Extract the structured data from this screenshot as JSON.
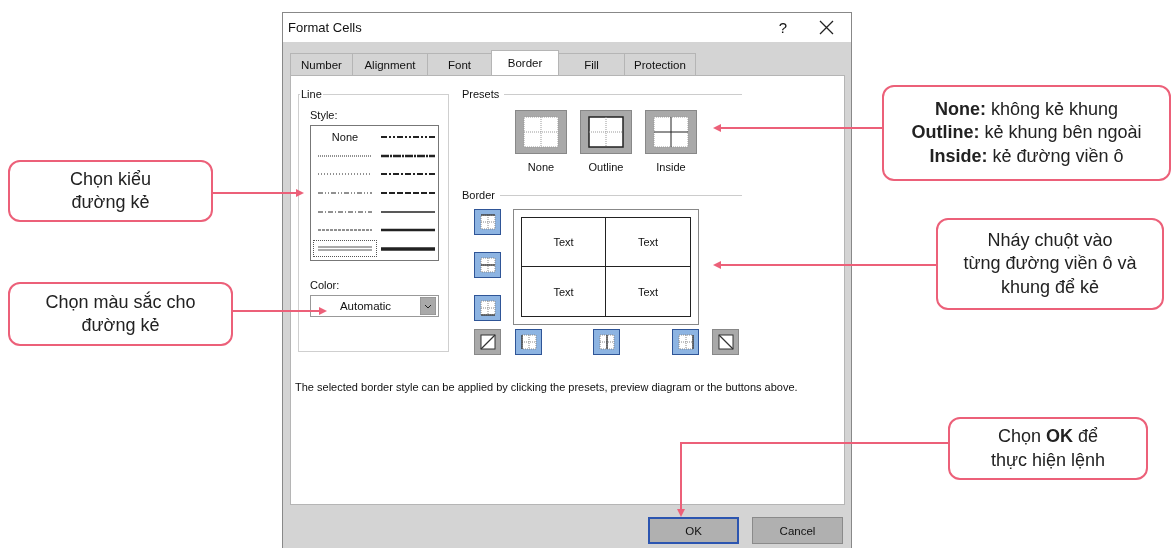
{
  "window": {
    "title": "Format Cells",
    "help_label": "?"
  },
  "tabs": [
    {
      "label": "Number",
      "selected": false
    },
    {
      "label": "Alignment",
      "selected": false
    },
    {
      "label": "Font",
      "selected": false
    },
    {
      "label": "Border",
      "selected": true
    },
    {
      "label": "Fill",
      "selected": false
    },
    {
      "label": "Protection",
      "selected": false
    }
  ],
  "line": {
    "title": "Line",
    "style_label": "Style:",
    "styles": [
      {
        "kind": "none",
        "label": "None",
        "selected": false
      },
      {
        "kind": "hair",
        "selected": false
      },
      {
        "kind": "dotted",
        "selected": false
      },
      {
        "kind": "dash_dot_dot",
        "selected": false
      },
      {
        "kind": "dash_dot",
        "selected": false
      },
      {
        "kind": "dashed",
        "selected": false
      },
      {
        "kind": "double",
        "selected": true
      },
      {
        "kind": "medium_dash_dot_dot",
        "selected": false
      },
      {
        "kind": "slant_dash_dot",
        "selected": false
      },
      {
        "kind": "medium_dash_dot",
        "selected": false
      },
      {
        "kind": "medium_dashed",
        "selected": false
      },
      {
        "kind": "thin",
        "selected": false
      },
      {
        "kind": "medium",
        "selected": false
      },
      {
        "kind": "thick",
        "selected": false
      }
    ],
    "color_label": "Color:",
    "color_value": "Automatic"
  },
  "presets": {
    "title": "Presets",
    "items": [
      {
        "kind": "none",
        "label": "None"
      },
      {
        "kind": "outline",
        "label": "Outline"
      },
      {
        "kind": "inside",
        "label": "Inside"
      }
    ]
  },
  "border": {
    "title": "Border",
    "preview_cells": [
      "Text",
      "Text",
      "Text",
      "Text"
    ],
    "side_buttons": [
      {
        "kind": "top",
        "selected": true
      },
      {
        "kind": "middle",
        "selected": true
      },
      {
        "kind": "bottom",
        "selected": true
      }
    ],
    "bottom_buttons": [
      {
        "kind": "diag_up",
        "selected": false
      },
      {
        "kind": "left",
        "selected": true
      },
      {
        "kind": "center",
        "selected": true
      },
      {
        "kind": "right",
        "selected": true
      },
      {
        "kind": "diag_down",
        "selected": false
      }
    ]
  },
  "hint": "The selected border style can be applied by clicking the presets, preview diagram or the buttons above.",
  "buttons": [
    {
      "label": "OK",
      "kind": "default"
    },
    {
      "label": "Cancel",
      "kind": "normal"
    }
  ],
  "left_callouts": [
    {
      "text": "Chọn kiểu\nđường kẻ"
    },
    {
      "text": "Chọn màu sắc cho\nđường kẻ"
    }
  ],
  "right_callouts": [
    {
      "text": "**None:** không kẻ khung\n**Outline:** kẻ khung bên ngoài\n**Inside:** kẻ đường viền ô"
    },
    {
      "text": "Nháy chuột vào\ntừng đường viền ô và\nkhung để kẻ"
    },
    {
      "text": "Chọn **OK** để\nthực hiện lệnh"
    }
  ]
}
